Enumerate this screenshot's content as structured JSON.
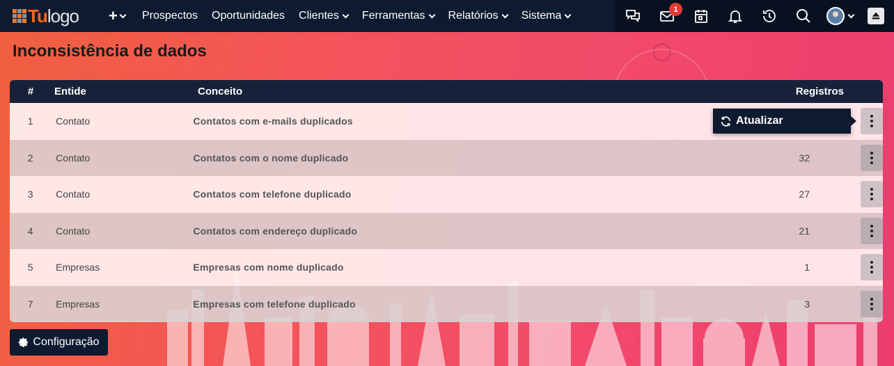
{
  "nav": {
    "logo_tu": "Tu",
    "logo_rest": "logo",
    "plus_label": "+",
    "items": [
      "Prospectos",
      "Oportunidades",
      "Clientes",
      "Ferramentas",
      "Relatórios",
      "Sistema"
    ],
    "mail_badge": "1"
  },
  "page": {
    "title": "Inconsistência de dados"
  },
  "table": {
    "headers": [
      "#",
      "Entide",
      "Conceito",
      "Registros"
    ],
    "rows": [
      {
        "num": "1",
        "entity": "Contato",
        "concept": "Contatos com e-mails duplicados",
        "count": ""
      },
      {
        "num": "2",
        "entity": "Contato",
        "concept": "Contatos com o nome duplicado",
        "count": "32"
      },
      {
        "num": "3",
        "entity": "Contato",
        "concept": "Contatos com telefone duplicado",
        "count": "27"
      },
      {
        "num": "4",
        "entity": "Contato",
        "concept": "Contatos com endereço duplicado",
        "count": "21"
      },
      {
        "num": "5",
        "entity": "Empresas",
        "concept": "Empresas com nome duplicado",
        "count": "1"
      },
      {
        "num": "7",
        "entity": "Empresas",
        "concept": "Empresas com telefone duplicado",
        "count": "3"
      }
    ]
  },
  "popup": {
    "label": "Atualizar"
  },
  "config": {
    "label": "Configuração"
  },
  "colors": {
    "navbar": "#0e1a30",
    "table_header": "#17223a",
    "badge": "#e53935",
    "logo_accent": "#f26a1b"
  }
}
